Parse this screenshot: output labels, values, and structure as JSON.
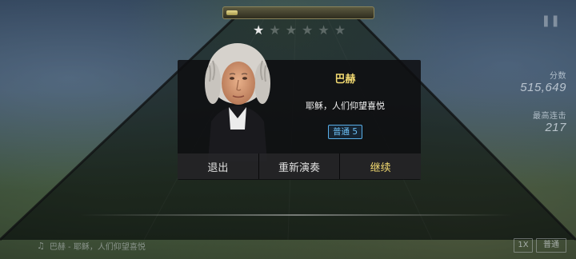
{
  "hud": {
    "progress": 0.08,
    "stars": [
      "on",
      "off",
      "off",
      "off",
      "off",
      "off"
    ],
    "pause_icon": "pause-icon",
    "score_label": "分数",
    "score_value": "515,649",
    "combo_label": "最高连击",
    "combo_value": "217"
  },
  "dialog": {
    "composer": "巴赫",
    "song": "耶稣，人们仰望喜悦",
    "difficulty_badge": "普通 5",
    "buttons": {
      "exit": "退出",
      "restart": "重新演奏",
      "continue": "继续"
    }
  },
  "footer": {
    "now_playing": "巴赫 - 耶稣，人们仰望喜悦",
    "speed": "1X",
    "difficulty": "普通"
  },
  "colors": {
    "accent_gold": "#f0d870",
    "badge_blue": "#58aee8"
  }
}
